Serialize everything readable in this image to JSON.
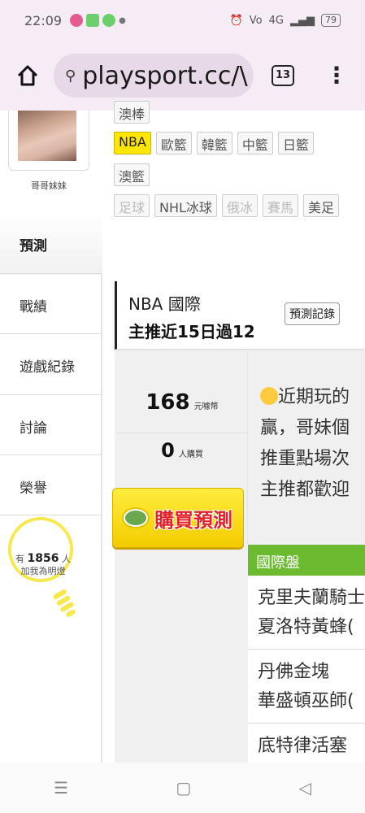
{
  "status": {
    "time": "22:09",
    "battery": "79",
    "signal": "4G"
  },
  "browser": {
    "url": "playsport.cc/\\",
    "tab_count": "13"
  },
  "profile": {
    "name": "哥哥妹妹"
  },
  "categories": {
    "row0": [
      "澳棒"
    ],
    "row1": [
      "NBA",
      "歐籃",
      "韓籃",
      "中籃",
      "日籃"
    ],
    "row2": [
      "澳籃"
    ],
    "row3": [
      "足球",
      "NHL冰球",
      "俄冰",
      "賽馬",
      "美足"
    ]
  },
  "nav": {
    "active": "預測",
    "items": [
      "戰績",
      "遊戲紀錄",
      "討論",
      "榮譽"
    ]
  },
  "follow": {
    "prefix": "有",
    "count": "1856",
    "suffix": "人",
    "label": "加我為明燈"
  },
  "header": {
    "title": "NBA 國際",
    "subtitle": "主推近15日過12",
    "record_button": "預測記錄"
  },
  "price": {
    "amount": "168",
    "unit": "元噱幣"
  },
  "buyers": {
    "count": "0",
    "unit": "人購買"
  },
  "buy_button": {
    "label": "購買預測"
  },
  "description": [
    "近期玩的",
    "贏，哥妹個",
    "推重點場次",
    "主推都歡迎"
  ],
  "games": {
    "section_title": "國際盤",
    "items": [
      {
        "home": "克里夫蘭騎士",
        "away": "夏洛特黃蜂("
      },
      {
        "home": "丹佛金塊",
        "away": "華盛頓巫師("
      },
      {
        "home": "底特律活塞",
        "away": ""
      }
    ]
  }
}
